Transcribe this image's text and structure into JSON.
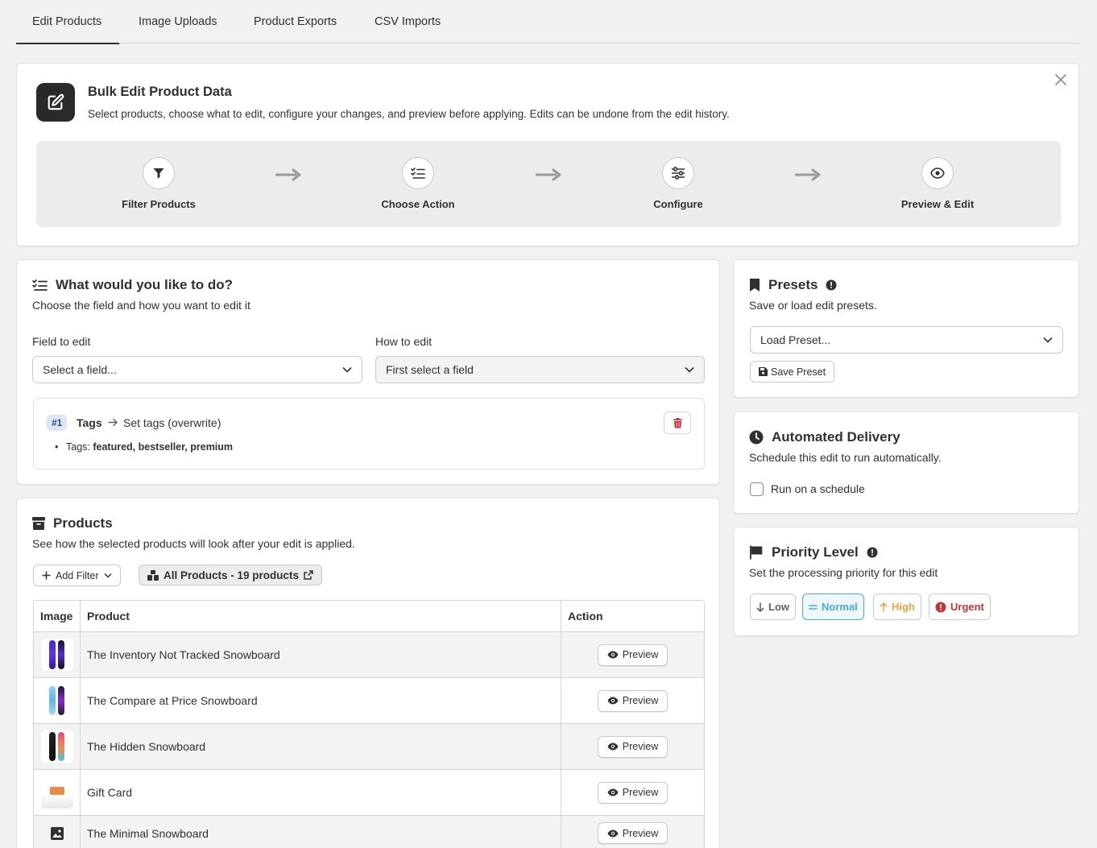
{
  "tabs": [
    "Edit Products",
    "Image Uploads",
    "Product Exports",
    "CSV Imports"
  ],
  "hero": {
    "title": "Bulk Edit Product Data",
    "subtitle": "Select products, choose what to edit, configure your changes, and preview before applying. Edits can be undone from the edit history.",
    "steps": [
      "Filter Products",
      "Choose Action",
      "Configure",
      "Preview & Edit"
    ]
  },
  "what": {
    "title": "What would you like to do?",
    "subtitle": "Choose the field and how you want to edit it",
    "field_label": "Field to edit",
    "field_value": "Select a field...",
    "how_label": "How to edit",
    "how_value": "First select a field",
    "edit": {
      "number": "#1",
      "field": "Tags",
      "action": "Set tags (overwrite)",
      "detail_label": "Tags: ",
      "detail_value": "featured, bestseller, premium"
    }
  },
  "products": {
    "title": "Products",
    "subtitle": "See how the selected products will look after your edit is applied.",
    "add_filter": "Add Filter",
    "all_products": "All Products - 19 products",
    "columns": [
      "Image",
      "Product",
      "Action"
    ],
    "preview_label": "Preview",
    "rows": [
      {
        "name": "The Inventory Not Tracked Snowboard"
      },
      {
        "name": "The Compare at Price Snowboard"
      },
      {
        "name": "The Hidden Snowboard"
      },
      {
        "name": "Gift Card"
      },
      {
        "name": "The Minimal Snowboard"
      }
    ]
  },
  "presets": {
    "title": "Presets",
    "subtitle": "Save or load edit presets.",
    "load_value": "Load Preset...",
    "save_label": "Save Preset"
  },
  "auto": {
    "title": "Automated Delivery",
    "subtitle": "Schedule this edit to run automatically.",
    "checkbox_label": "Run on a schedule"
  },
  "priority": {
    "title": "Priority Level",
    "subtitle": "Set the processing priority for this edit",
    "options": [
      {
        "label": "Low",
        "color": "#616161"
      },
      {
        "label": "Normal",
        "color": "#4aa8d8"
      },
      {
        "label": "High",
        "color": "#e8a33d"
      },
      {
        "label": "Urgent",
        "color": "#c4323a"
      }
    ],
    "selected": "Normal"
  }
}
